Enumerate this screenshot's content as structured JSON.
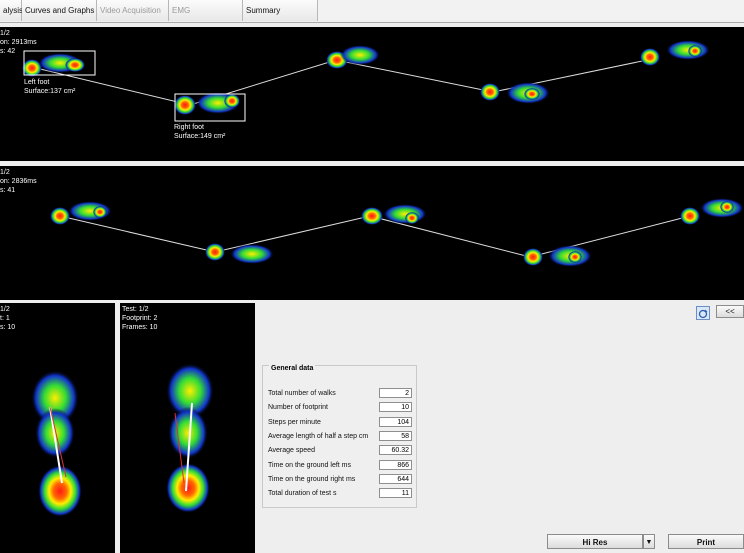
{
  "tabs": [
    {
      "label": "alysis",
      "enabled": true
    },
    {
      "label": "Curves and Graphs",
      "enabled": true
    },
    {
      "label": "Video Acquisition",
      "enabled": false
    },
    {
      "label": "EMG",
      "enabled": false
    },
    {
      "label": "Summary",
      "enabled": true
    }
  ],
  "panel1": {
    "info": [
      "1/2",
      "on: 2913ms",
      "s: 42"
    ],
    "left_foot": {
      "name": "Left foot",
      "surface": "Surface:137 cm²"
    },
    "right_foot": {
      "name": "Right foot",
      "surface": "Surface:149 cm²"
    }
  },
  "panel2": {
    "info": [
      "1/2",
      "on: 2836ms",
      "s: 41"
    ]
  },
  "panel3": {
    "info": [
      "1/2",
      "t: 1",
      "s: 10"
    ]
  },
  "panel4": {
    "info": [
      "Test: 1/2",
      "Footprint: 2",
      "Frames: 10"
    ]
  },
  "general_data": {
    "title": "General data",
    "rows": [
      {
        "label": "Total number of walks",
        "value": "2"
      },
      {
        "label": "Number of footprint",
        "value": "10"
      },
      {
        "label": "Steps per minute",
        "value": "104"
      },
      {
        "label": "Average length of half a step cm",
        "value": "58"
      },
      {
        "label": "Average speed",
        "value": "60.32"
      },
      {
        "label": "Time on the ground left ms",
        "value": "866"
      },
      {
        "label": "Time on the ground right ms",
        "value": "644"
      },
      {
        "label": "Total duration of test s",
        "value": "11"
      }
    ]
  },
  "controls": {
    "collapse_label": "<<",
    "resolution_selected": "Hi Res",
    "print_label": "Print",
    "dropdown_arrow": "▼"
  },
  "icons": {
    "refresh": "refresh-icon",
    "dropdown": "dropdown-arrow-icon"
  }
}
